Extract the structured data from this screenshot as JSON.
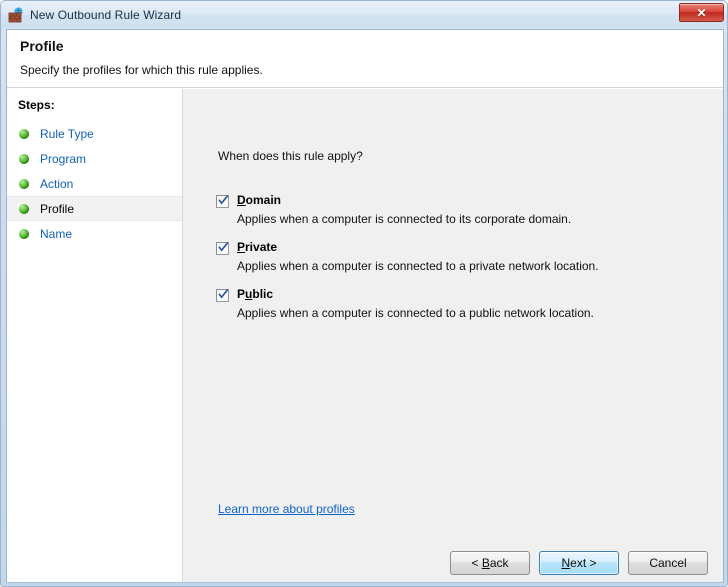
{
  "window": {
    "title": "New Outbound Rule Wizard",
    "icon": "firewall-icon",
    "close_label": "✕"
  },
  "header": {
    "title": "Profile",
    "subtitle": "Specify the profiles for which this rule applies."
  },
  "sidebar": {
    "heading": "Steps:",
    "items": [
      {
        "label": "Rule Type",
        "current": false
      },
      {
        "label": "Program",
        "current": false
      },
      {
        "label": "Action",
        "current": false
      },
      {
        "label": "Profile",
        "current": true
      },
      {
        "label": "Name",
        "current": false
      }
    ]
  },
  "main": {
    "question": "When does this rule apply?",
    "options": [
      {
        "label_pre": "",
        "label_accel": "D",
        "label_post": "omain",
        "checked": true,
        "description": "Applies when a computer is connected to its corporate domain."
      },
      {
        "label_pre": "",
        "label_accel": "P",
        "label_post": "rivate",
        "checked": true,
        "description": "Applies when a computer is connected to a private network location."
      },
      {
        "label_pre": "P",
        "label_accel": "u",
        "label_post": "blic",
        "checked": true,
        "description": "Applies when a computer is connected to a public network location."
      }
    ],
    "learn_more_link": "Learn more about profiles"
  },
  "footer": {
    "buttons": [
      {
        "pre": "< ",
        "accel": "B",
        "post": "ack",
        "default": false
      },
      {
        "pre": "",
        "accel": "N",
        "post": "ext >",
        "default": true
      },
      {
        "pre": "Cancel",
        "accel": "",
        "post": "",
        "default": false
      }
    ]
  },
  "colors": {
    "link": "#0e63c8",
    "step_link": "#1061b5",
    "panel_bg": "#f0f0f0",
    "default_button_border": "#3c7fb1",
    "close_button": "#c0291d"
  }
}
